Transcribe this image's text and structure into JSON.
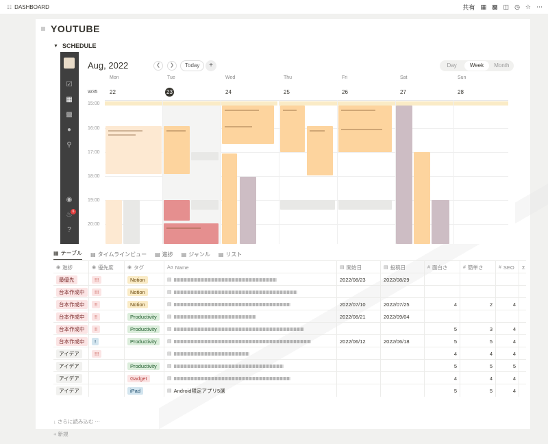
{
  "topbar": {
    "breadcrumb": "DASHBOARD",
    "share": "共有"
  },
  "page": {
    "title": "YOUTUBE",
    "section": "SCHEDULE"
  },
  "calendar": {
    "month": "Aug, 2022",
    "today_label": "Today",
    "plus": "+",
    "views": [
      "Day",
      "Week",
      "Month"
    ],
    "active_view": "Week",
    "week_label": "W35",
    "days": [
      {
        "name": "Mon",
        "num": "22"
      },
      {
        "name": "Tue",
        "num": "23"
      },
      {
        "name": "Wed",
        "num": "24"
      },
      {
        "name": "Thu",
        "num": "25"
      },
      {
        "name": "Fri",
        "num": "26"
      },
      {
        "name": "Sat",
        "num": "27"
      },
      {
        "name": "Sun",
        "num": "28"
      }
    ],
    "hours": [
      "15:00",
      "16:00",
      "17:00",
      "18:00",
      "19:00",
      "20:00"
    ],
    "notification_count": "6",
    "colors": {
      "orange": "#fdd49e",
      "peach": "#fde9d2",
      "red": "#e58f8f",
      "mauve": "#cdbdc4",
      "gray": "#e8e8e6",
      "allday": "#faebc6"
    }
  },
  "views": {
    "tabs": [
      "テーブル",
      "タイムラインビュー",
      "進捗",
      "ジャンル",
      "リスト"
    ],
    "active": "テーブル"
  },
  "table": {
    "headers": [
      "進捗",
      "優先度",
      "タグ",
      "Name",
      "開始日",
      "投稿日",
      "面白さ",
      "簡単さ",
      "SEO",
      "Σ"
    ],
    "rows": [
      {
        "status": "最優先",
        "priority": "!!!",
        "tag": "Notion",
        "start": "2022/08/23",
        "post": "2022/08/29",
        "fun": "",
        "easy": "",
        "seo": ""
      },
      {
        "status": "台本作成中",
        "priority": "!!!",
        "tag": "Notion",
        "start": "",
        "post": "",
        "fun": "",
        "easy": "",
        "seo": ""
      },
      {
        "status": "台本作成中",
        "priority": "!!",
        "tag": "Notion",
        "start": "2022/07/10",
        "post": "2022/07/25",
        "fun": "4",
        "easy": "2",
        "seo": "4"
      },
      {
        "status": "台本作成中",
        "priority": "!!",
        "tag": "Productivity",
        "start": "2022/08/21",
        "post": "2022/09/04",
        "fun": "",
        "easy": "",
        "seo": ""
      },
      {
        "status": "台本作成中",
        "priority": "!!",
        "tag": "Productivity",
        "start": "",
        "post": "",
        "fun": "5",
        "easy": "3",
        "seo": "4"
      },
      {
        "status": "台本作成中",
        "priority": "!",
        "tag": "Productivity",
        "start": "2022/06/12",
        "post": "2022/06/18",
        "fun": "5",
        "easy": "5",
        "seo": "4"
      },
      {
        "status": "アイデア",
        "priority": "!!!",
        "tag": "",
        "start": "",
        "post": "",
        "fun": "4",
        "easy": "4",
        "seo": "4"
      },
      {
        "status": "アイデア",
        "priority": "",
        "tag": "Productivity",
        "start": "",
        "post": "",
        "fun": "5",
        "easy": "5",
        "seo": "5"
      },
      {
        "status": "アイデア",
        "priority": "",
        "tag": "Gadget",
        "start": "",
        "post": "",
        "fun": "4",
        "easy": "4",
        "seo": "4"
      },
      {
        "status": "アイデア",
        "priority": "",
        "tag": "iPad",
        "name": "Android限定アプリ5選",
        "start": "",
        "post": "",
        "fun": "5",
        "easy": "5",
        "seo": "4"
      }
    ],
    "load_more": "さらに読み込む",
    "new_row": "新規"
  }
}
